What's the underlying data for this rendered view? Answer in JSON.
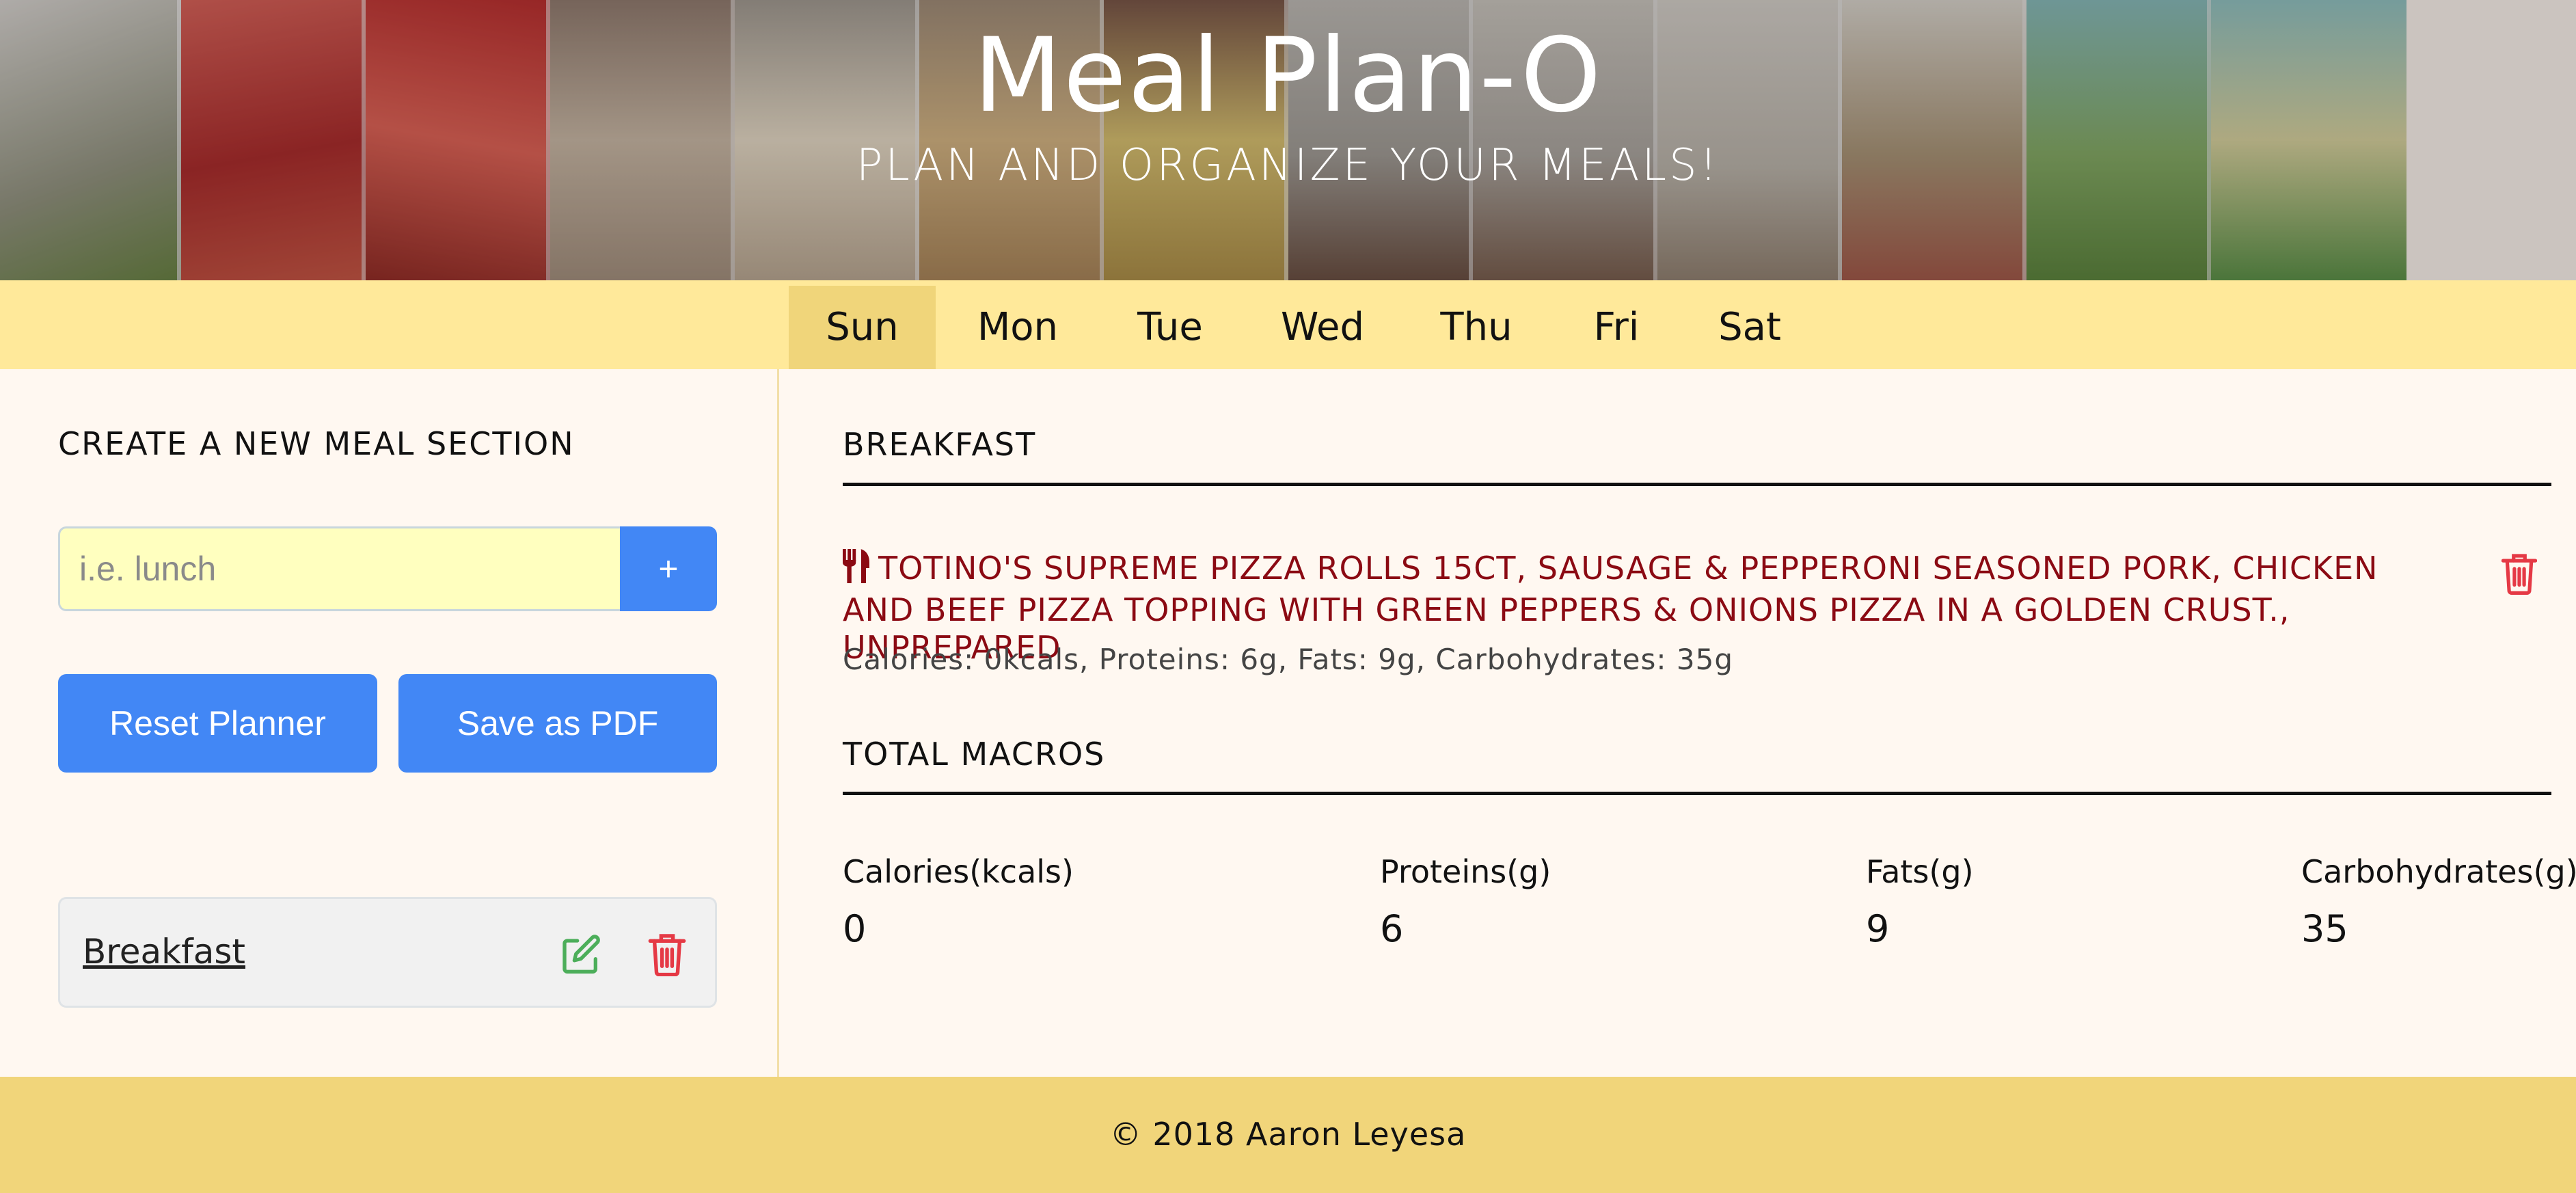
{
  "header": {
    "title": "Meal Plan-O",
    "subtitle": "PLAN AND ORGANIZE YOUR MEALS!"
  },
  "days": {
    "items": [
      "Sun",
      "Mon",
      "Tue",
      "Wed",
      "Thu",
      "Fri",
      "Sat"
    ],
    "active": "Sun"
  },
  "sidebar": {
    "heading": "CREATE A NEW MEAL SECTION",
    "input_placeholder": "i.e. lunch",
    "input_value": "",
    "add_label": "+",
    "reset_label": "Reset Planner",
    "pdf_label": "Save as PDF",
    "sections": [
      {
        "name": "Breakfast",
        "edit_icon": "edit-icon",
        "delete_icon": "trash-icon"
      }
    ]
  },
  "main": {
    "meal_heading": "BREAKFAST",
    "food": {
      "icon": "utensils-icon",
      "name": "TOTINO'S SUPREME PIZZA ROLLS 15CT, SAUSAGE & PEPPERONI SEASONED PORK, CHICKEN AND BEEF PIZZA TOPPING WITH GREEN PEPPERS & ONIONS PIZZA IN A GOLDEN CRUST., UNPREPARED",
      "macros": "Calories: 0kcals, Proteins: 6g, Fats: 9g, Carbohydrates: 35g"
    },
    "totals_heading": "TOTAL MACROS",
    "totals": {
      "calories_label": "Calories(kcals)",
      "calories_value": "0",
      "proteins_label": "Proteins(g)",
      "proteins_value": "6",
      "fats_label": "Fats(g)",
      "fats_value": "9",
      "carbs_label": "Carbohydrates(g)",
      "carbs_value": "35"
    }
  },
  "footer": {
    "text": "© 2018 Aaron Leyesa"
  },
  "colors": {
    "accent_blue": "#4287f5",
    "nav_yellow": "#ffe99a",
    "footer_yellow": "#f1d57a",
    "food_red": "#8b0a13",
    "delete_red": "#e53945",
    "edit_green": "#4cae5a"
  }
}
